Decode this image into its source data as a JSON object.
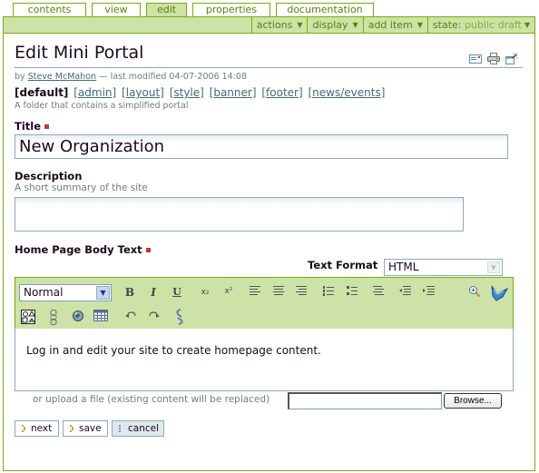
{
  "tabs": [
    {
      "label": "contents",
      "active": false
    },
    {
      "label": "view",
      "active": false
    },
    {
      "label": "edit",
      "active": true
    },
    {
      "label": "properties",
      "active": false
    },
    {
      "label": "documentation",
      "active": false
    }
  ],
  "actionbar": {
    "actions_label": "actions",
    "display_label": "display",
    "add_item_label": "add item",
    "state_label": "state:",
    "state_value": "public draft",
    "caret": "▼"
  },
  "page": {
    "title": "Edit Mini Portal",
    "byline_prefix": "by",
    "author": "Steve McMahon",
    "byline_suffix": "— last modified 04-07-2006 14:08",
    "doc_actions": [
      "send-to-icon",
      "print-icon",
      "full-screen-icon"
    ]
  },
  "subnav": {
    "current": "[default]",
    "links": [
      "[admin]",
      "[layout]",
      "[style]",
      "[banner]",
      "[footer]",
      "[news/events]"
    ]
  },
  "folder_description": "A folder that contains a simplified portal",
  "form": {
    "title_label": "Title",
    "title_value": "New Organization",
    "description_label": "Description",
    "description_help": "A short summary of the site",
    "description_value": "",
    "body_label": "Home Page Body Text",
    "text_format_label": "Text Format",
    "text_format_value": "HTML",
    "editor": {
      "style_value": "Normal",
      "toolbar_row1": [
        "bold",
        "italic",
        "underline",
        "subscript",
        "superscript",
        "align-left",
        "align-center",
        "align-right",
        "numbered-list",
        "bulleted-list",
        "definition-list",
        "outdent",
        "indent",
        "zoom",
        "kupu-logo"
      ],
      "toolbar_row2": [
        "insert-image",
        "insert-link",
        "external-link",
        "insert-table",
        "undo",
        "redo",
        "remove-link"
      ],
      "bold_glyph": "B",
      "italic_glyph": "I",
      "underline_glyph": "U",
      "subscript_glyph": "x₂",
      "superscript_glyph": "x²",
      "content": "Log in and edit your site to create homepage content."
    },
    "upload_label": "or upload a file (existing content will be replaced)",
    "browse_label": "Browse..."
  },
  "buttons": {
    "next": "next",
    "save": "save",
    "cancel": "cancel"
  }
}
